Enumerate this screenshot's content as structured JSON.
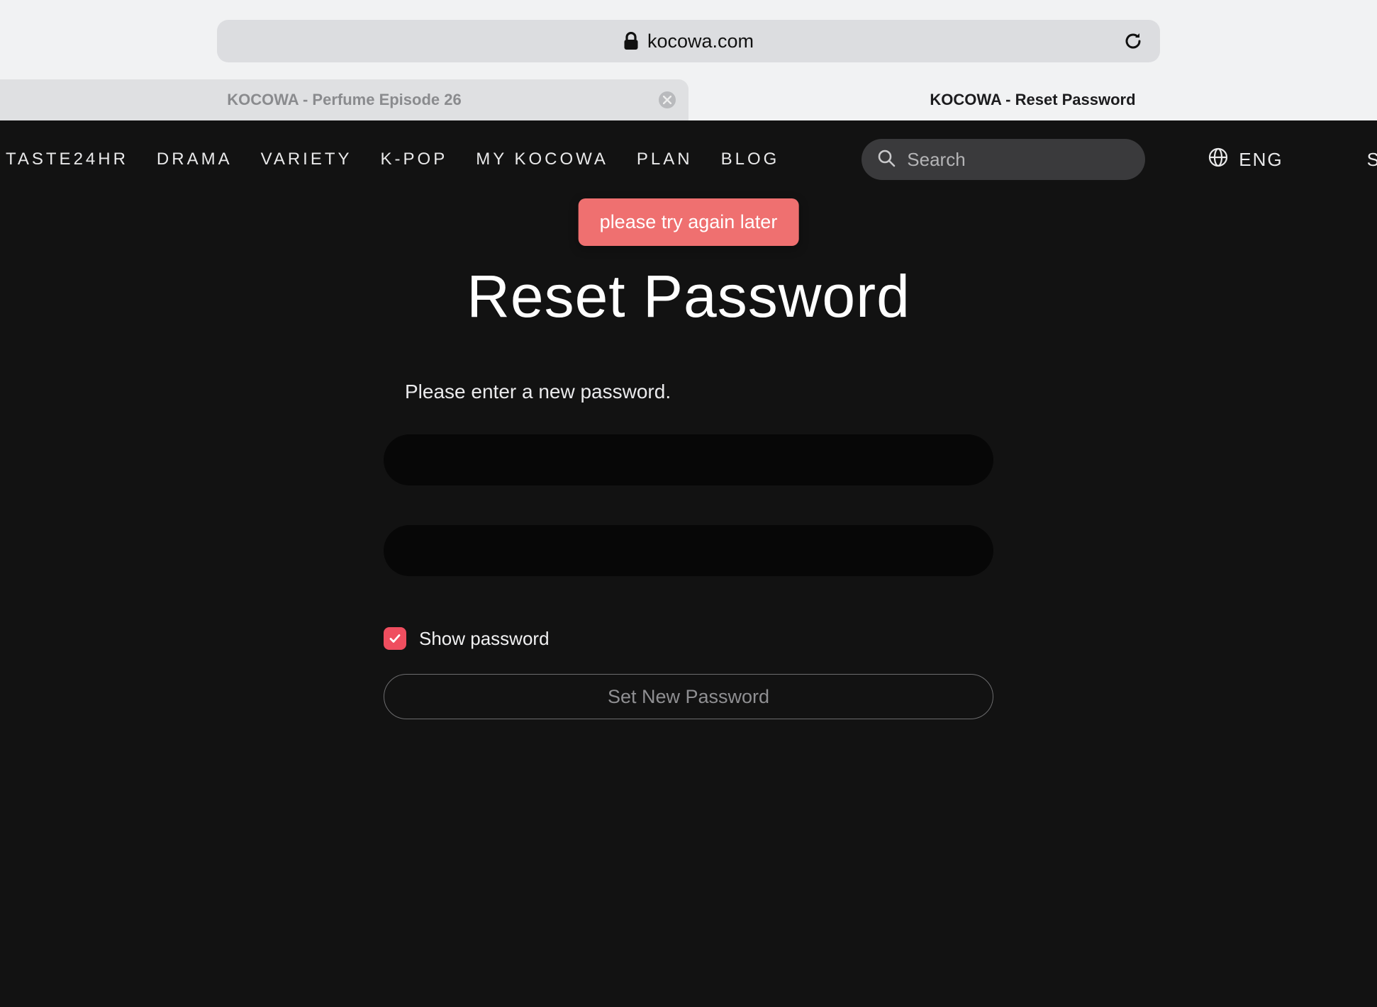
{
  "browser": {
    "address": "kocowa.com",
    "tabs": [
      {
        "title": "KOCOWA - Perfume Episode 26",
        "active": false
      },
      {
        "title": "KOCOWA - Reset Password",
        "active": true
      }
    ]
  },
  "nav": {
    "items": [
      "TASTE24HR",
      "DRAMA",
      "VARIETY",
      "K-POP",
      "MY KOCOWA",
      "PLAN",
      "BLOG"
    ],
    "search_placeholder": "Search",
    "language": "ENG",
    "sign": "SIGN"
  },
  "toast": {
    "message": "please try again later"
  },
  "reset": {
    "title": "Reset Password",
    "subtitle": "Please enter a new password.",
    "field1_value": "",
    "field2_value": "",
    "show_password_label": "Show password",
    "show_password_checked": true,
    "submit_label": "Set New Password"
  },
  "colors": {
    "accent": "#ef4e5f",
    "toast": "#ef7070",
    "page_bg": "#121212"
  }
}
